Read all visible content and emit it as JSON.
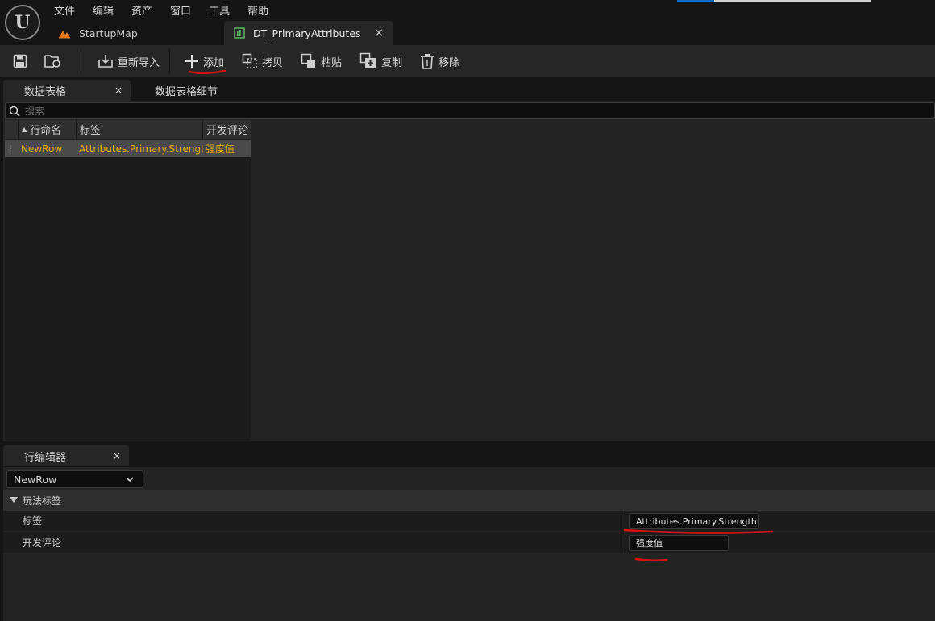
{
  "menu": [
    "文件",
    "编辑",
    "资产",
    "窗口",
    "工具",
    "帮助"
  ],
  "doc_tabs": {
    "map_label": "StartupMap",
    "asset_label": "DT_PrimaryAttributes",
    "close": "×"
  },
  "toolbar": {
    "reimport": "重新导入",
    "add": "添加",
    "copy": "拷贝",
    "paste": "粘贴",
    "duplicate": "复制",
    "remove": "移除"
  },
  "table_panel": {
    "tab_active": "数据表格",
    "tab_inactive": "数据表格细节",
    "close": "×",
    "search_placeholder": "搜索"
  },
  "grid": {
    "headers": [
      "行命名",
      "标签",
      "开发评论"
    ],
    "rows": [
      {
        "index": "1",
        "name": "NewRow",
        "tag": "Attributes.Primary.Strength",
        "comment": "强度值"
      }
    ]
  },
  "row_editor": {
    "tab": "行编辑器",
    "close": "×",
    "selected_row": "NewRow",
    "category": "玩法标签",
    "props": [
      {
        "label": "标签",
        "value": "Attributes.Primary.Strength"
      },
      {
        "label": "开发评论",
        "value": "强度值"
      }
    ]
  },
  "colors": {
    "accent_yellow": "#f0b000",
    "annotation_red": "#d81010",
    "map_icon": "#e07a1a",
    "table_icon": "#5cb85c"
  }
}
